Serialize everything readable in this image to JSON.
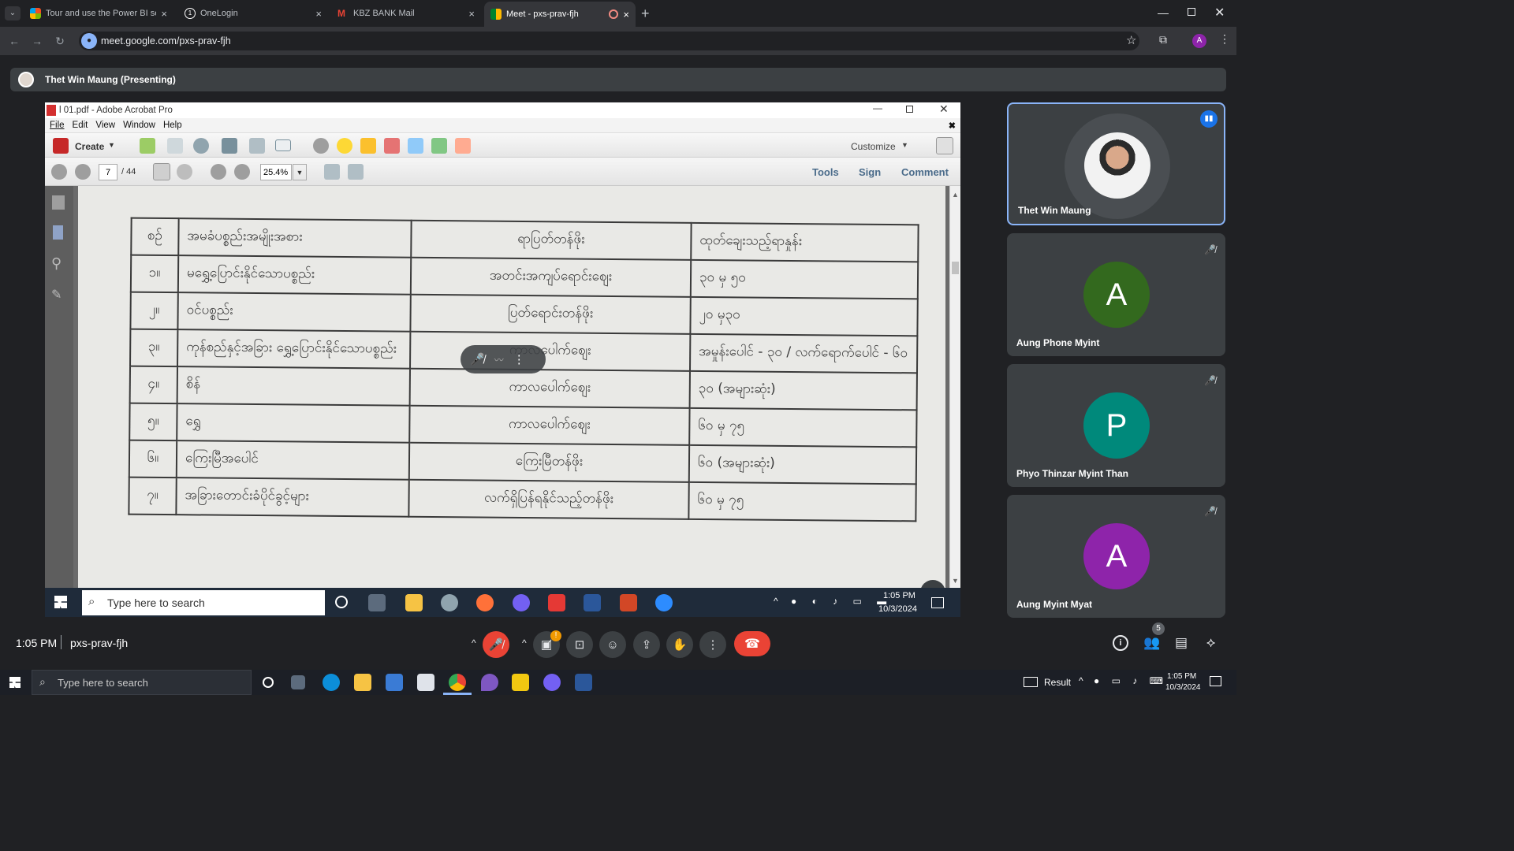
{
  "browser": {
    "tabs": [
      {
        "title": "Tour and use the Power BI servi",
        "icon": "power-bi-icon",
        "color": "#f2c811"
      },
      {
        "title": "OneLogin",
        "icon": "onelogin-icon",
        "color": "#ffffff"
      },
      {
        "title": "KBZ BANK Mail",
        "icon": "gmail-icon",
        "color": "#ea4335"
      },
      {
        "title": "Meet - pxs-prav-fjh",
        "icon": "meet-icon",
        "color": "#34a853"
      }
    ],
    "url": "meet.google.com/pxs-prav-fjh",
    "profile_letter": "A"
  },
  "meet": {
    "presenter_label": "Thet Win Maung (Presenting)",
    "time": "1:05 PM",
    "meeting_code": "pxs-prav-fjh",
    "participant_count": "5",
    "participants": [
      {
        "name": "Thet Win Maung",
        "letter": "",
        "color": "#5f6368",
        "speaking": true
      },
      {
        "name": "Aung Phone Myint",
        "letter": "A",
        "color": "#33691e",
        "speaking": false
      },
      {
        "name": "Phyo Thinzar Myint Than",
        "letter": "P",
        "color": "#00897b",
        "speaking": false
      },
      {
        "name": "Aung Myint Myat",
        "letter": "A",
        "color": "#8e24aa",
        "speaking": false
      }
    ]
  },
  "acrobat": {
    "title": "l 01.pdf - Adobe Acrobat Pro",
    "menu": [
      "File",
      "Edit",
      "View",
      "Window",
      "Help"
    ],
    "create_label": "Create",
    "customize_label": "Customize",
    "page_current": "7",
    "page_total": "/ 44",
    "zoom": "25.4%",
    "tools_label": "Tools",
    "sign_label": "Sign",
    "comment_label": "Comment"
  },
  "document_table": {
    "headers": [
      "စဉ်",
      "အမခံပစ္စည်းအမျိုးအစား",
      "ရာပြတ်တန်ဖိုး",
      "ထုတ်ချေးသည့်ရာနှုန်း"
    ],
    "rows": [
      [
        "၁။",
        "မရွှေ့ပြောင်းနိုင်သောပစ္စည်း",
        "အတင်းအကျပ်ရောင်းဈေး",
        "၃၀ မှ ၅၀"
      ],
      [
        "၂။",
        "ဝင်ပစ္စည်း",
        "ပြတ်ရောင်းတန်ဖိုး",
        "၂၀ မှ၃၀"
      ],
      [
        "၃။",
        "ကုန်စည်နှင့်အခြား ရွှေ့ပြောင်းနိုင်သောပစ္စည်း",
        "ကာလပေါက်ဈေး",
        "အမှုန်းပေါင် - ၃၀ / လက်ရောက်ပေါင် - ၆၀"
      ],
      [
        "၄။",
        "စိန်",
        "ကာလပေါက်ဈေး",
        "၃၀ (အများဆုံး)"
      ],
      [
        "၅။",
        "ရွှေ",
        "ကာလပေါက်ဈေး",
        "၆၀ မှ ၇၅"
      ],
      [
        "၆။",
        "ကြေးမြီအပေါင်",
        "ကြေးမြီတန်ဖိုး",
        "၆၀ (အများဆုံး)"
      ],
      [
        "၇။",
        "အခြားတောင်းခံပိုင်ခွင့်များ",
        "လက်ရှိပြန်ရနိုင်သည့်တန်ဖိုး",
        "၆၀ မှ ၇၅"
      ]
    ]
  },
  "inner_taskbar": {
    "search_placeholder": "Type here to search",
    "time": "1:05 PM",
    "date": "10/3/2024"
  },
  "host_taskbar": {
    "search_placeholder": "Type here to search",
    "result_label": "Result",
    "time": "1:05 PM",
    "date": "10/3/2024"
  }
}
